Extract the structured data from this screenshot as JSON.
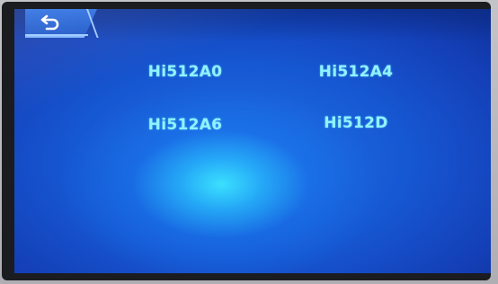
{
  "header": {
    "back_icon": "back-arrow-icon"
  },
  "models": [
    {
      "label": "Hi512A0"
    },
    {
      "label": "Hi512A4"
    },
    {
      "label": "Hi512A6"
    },
    {
      "label": "Hi512D"
    }
  ],
  "colors": {
    "screen_blue": "#1657d2",
    "glow_cyan": "#3ce6ff",
    "label_cyan": "#8ff3ff",
    "bezel": "#1b1c20"
  }
}
